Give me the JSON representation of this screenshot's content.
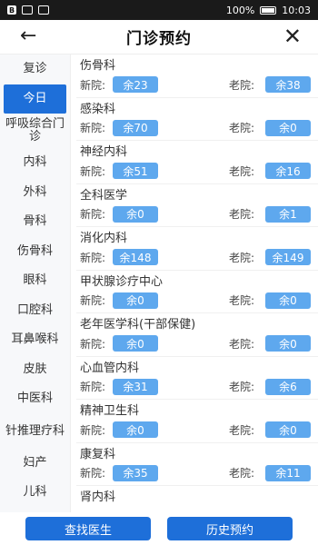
{
  "status_bar": {
    "badge": "B",
    "battery": "100%",
    "time": "10:03"
  },
  "header": {
    "title": "门诊预约",
    "back_icon": "←",
    "close_icon": "✕"
  },
  "sidebar": {
    "items": [
      {
        "label": "复诊"
      },
      {
        "label": "今日"
      },
      {
        "label": "呼吸综合门诊"
      },
      {
        "label": "内科"
      },
      {
        "label": "外科"
      },
      {
        "label": "骨科"
      },
      {
        "label": "伤骨科"
      },
      {
        "label": "眼科"
      },
      {
        "label": "口腔科"
      },
      {
        "label": "耳鼻喉科"
      },
      {
        "label": "皮肤"
      },
      {
        "label": "中医科"
      },
      {
        "label": "针推理疗科"
      },
      {
        "label": "妇产"
      },
      {
        "label": "儿科"
      }
    ]
  },
  "labels": {
    "new_campus": "新院:",
    "old_campus": "老院:"
  },
  "departments": [
    {
      "name": "伤骨科",
      "new": "余23",
      "old": "余38"
    },
    {
      "name": "感染科",
      "new": "余70",
      "old": "余0"
    },
    {
      "name": "神经内科",
      "new": "余51",
      "old": "余16"
    },
    {
      "name": "全科医学",
      "new": "余0",
      "old": "余1"
    },
    {
      "name": "消化内科",
      "new": "余148",
      "old": "余149"
    },
    {
      "name": "甲状腺诊疗中心",
      "new": "余0",
      "old": "余0"
    },
    {
      "name": "老年医学科(干部保健)",
      "new": "余0",
      "old": "余0"
    },
    {
      "name": "心血管内科",
      "new": "余31",
      "old": "余6"
    },
    {
      "name": "精神卫生科",
      "new": "余0",
      "old": "余0"
    },
    {
      "name": "康复科",
      "new": "余35",
      "old": "余11"
    },
    {
      "name": "肾内科",
      "new": "",
      "old": ""
    }
  ],
  "footer": {
    "find_doctor": "查找医生",
    "history": "历史预约"
  },
  "colors": {
    "accent": "#1e6fd9",
    "pill": "#5ea8ee"
  }
}
